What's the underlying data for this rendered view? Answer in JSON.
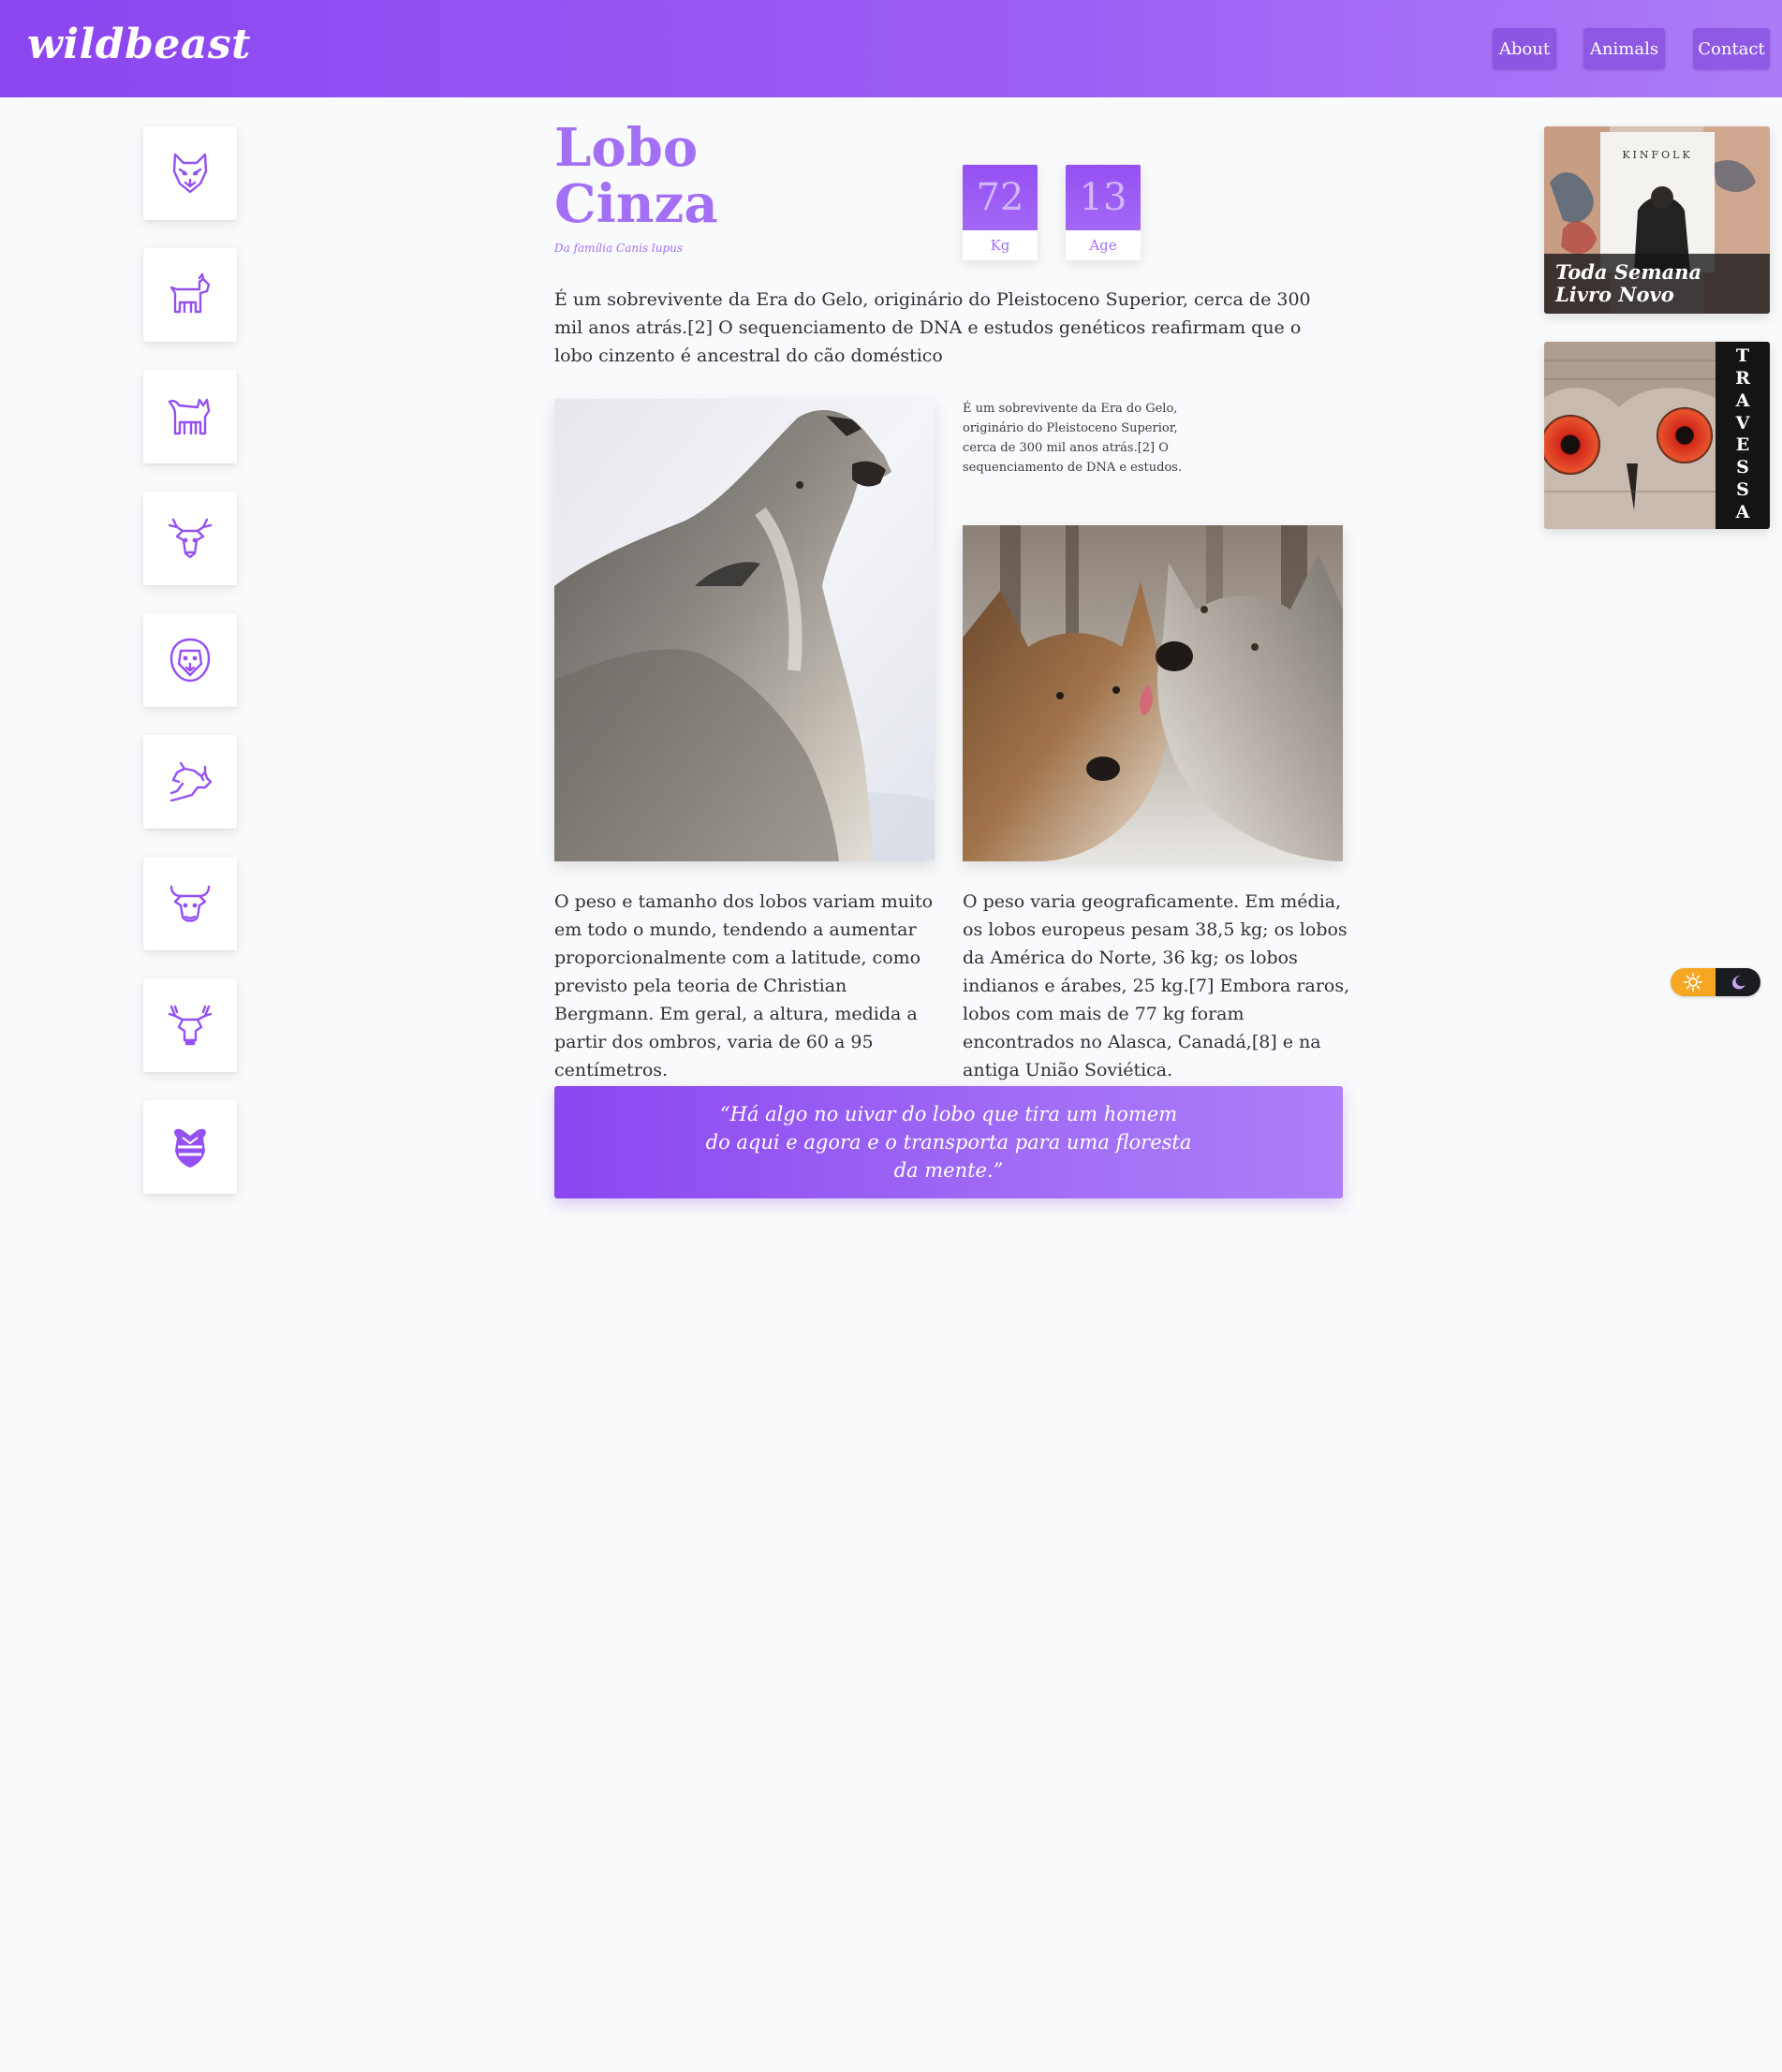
{
  "header": {
    "logo": "wildbeast",
    "nav": [
      "About",
      "Animals",
      "Contact"
    ]
  },
  "sidebar": {
    "icons": [
      "wolf-icon",
      "dog-icon",
      "cat-icon",
      "deer-icon",
      "lion-icon",
      "rhino-icon",
      "bull-icon",
      "moose-icon",
      "bee-icon"
    ],
    "accent": "#9450f2"
  },
  "article": {
    "title": "Lobo Cinza",
    "subtitle": "Da família Canis lupus",
    "stats": [
      {
        "value": "72",
        "label": "Kg"
      },
      {
        "value": "13",
        "label": "Age"
      }
    ],
    "intro": "É um sobrevivente da Era do Gelo, originário do Pleistoceno Superior, cerca de 300 mil anos atrás.[2] O sequenciamento de DNA e estudos genéticos reafirmam que o lobo cinzento é ancestral do cão doméstico",
    "side_note": "É um sobrevivente da Era do Gelo, originário do Pleistoceno Superior, cerca de 300 mil anos atrás.[2] O sequenciamento de DNA e estudos.",
    "col_left": "O peso e tamanho dos lobos variam muito em todo o mundo, tendendo a aumentar proporcionalmente com a latitude, como previsto pela teoria de Christian Bergmann. Em geral, a altura, medida a partir dos ombros, varia de 60 a 95 centímetros.",
    "col_right": "O peso varia geograficamente. Em média, os lobos europeus pesam 38,5 kg; os lobos da América do Norte, 36 kg; os lobos indianos e árabes, 25 kg.[7] Embora raros, lobos com mais de 77 kg foram encontrados no Alasca, Canadá,[8] e na antiga União Soviética.",
    "quote": "“Há algo no uivar do lobo que tira um homem do aqui e agora e o transporta para uma floresta da mente.”"
  },
  "ads": {
    "kinfolk": {
      "brand": "KINFOLK",
      "line1": "Toda Semana",
      "line2": "Livro Novo"
    },
    "travessa": {
      "letters": [
        "T",
        "R",
        "A",
        "V",
        "E",
        "S",
        "S",
        "A"
      ]
    }
  },
  "theme_toggle": {
    "light_icon": "sun-icon",
    "dark_icon": "moon-icon",
    "light_color": "#f5a623",
    "dark_color": "#1b1b22"
  },
  "colors": {
    "brand": "#9450f2",
    "brand_light": "#a36ff4",
    "background": "#f9fafb"
  }
}
